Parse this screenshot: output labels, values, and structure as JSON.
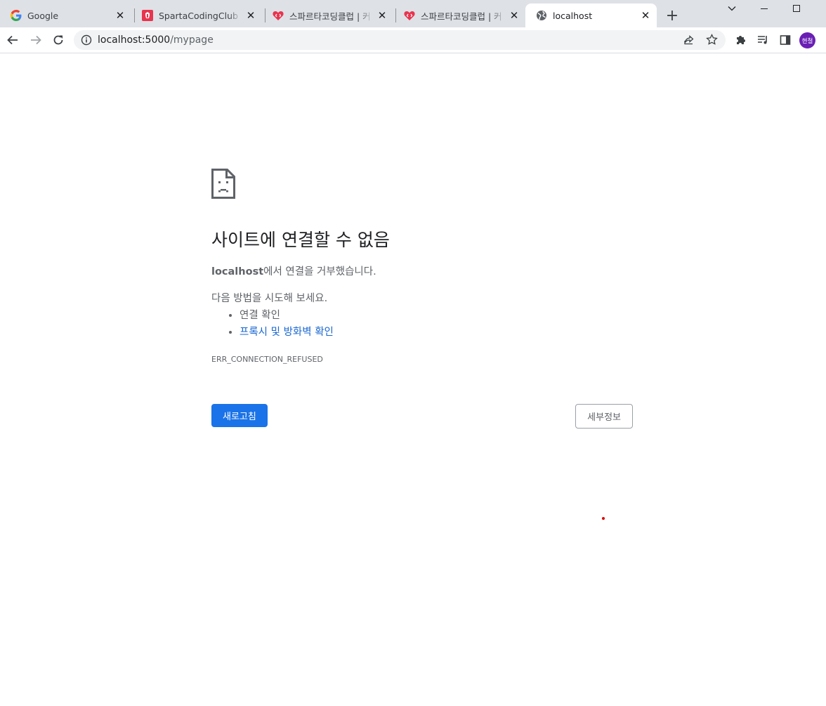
{
  "tabs": [
    {
      "title": "Google",
      "icon": "google-icon",
      "active": false
    },
    {
      "title": "SpartaCodingClub",
      "icon": "sparta-icon",
      "active": false
    },
    {
      "title": "스파르타코딩클럽 | 커",
      "icon": "heart-code-icon",
      "active": false
    },
    {
      "title": "스파르타코딩클럽 | 커",
      "icon": "heart-code-icon",
      "active": false
    },
    {
      "title": "localhost",
      "icon": "globe-icon",
      "active": true
    }
  ],
  "tab_close_glyph": "✕",
  "new_tab_glyph": "+",
  "address_bar": {
    "host": "localhost:5000",
    "path": "/mypage"
  },
  "profile": {
    "initials": "현철",
    "color": "#6a1fb4"
  },
  "error_page": {
    "heading": "사이트에 연결할 수 없음",
    "summary_host": "localhost",
    "summary_text": "에서 연결을 거부했습니다.",
    "suggestions_heading": "다음 방법을 시도해 보세요.",
    "suggestions": [
      {
        "text": "연결 확인",
        "link": false
      },
      {
        "text": "프록시 및 방화벽 확인",
        "link": true
      }
    ],
    "error_code": "ERR_CONNECTION_REFUSED",
    "reload_label": "새로고침",
    "details_label": "세부정보"
  },
  "colors": {
    "primary_button": "#1a73e8",
    "link": "#1967d2",
    "tab_strip": "#dee1e6"
  }
}
